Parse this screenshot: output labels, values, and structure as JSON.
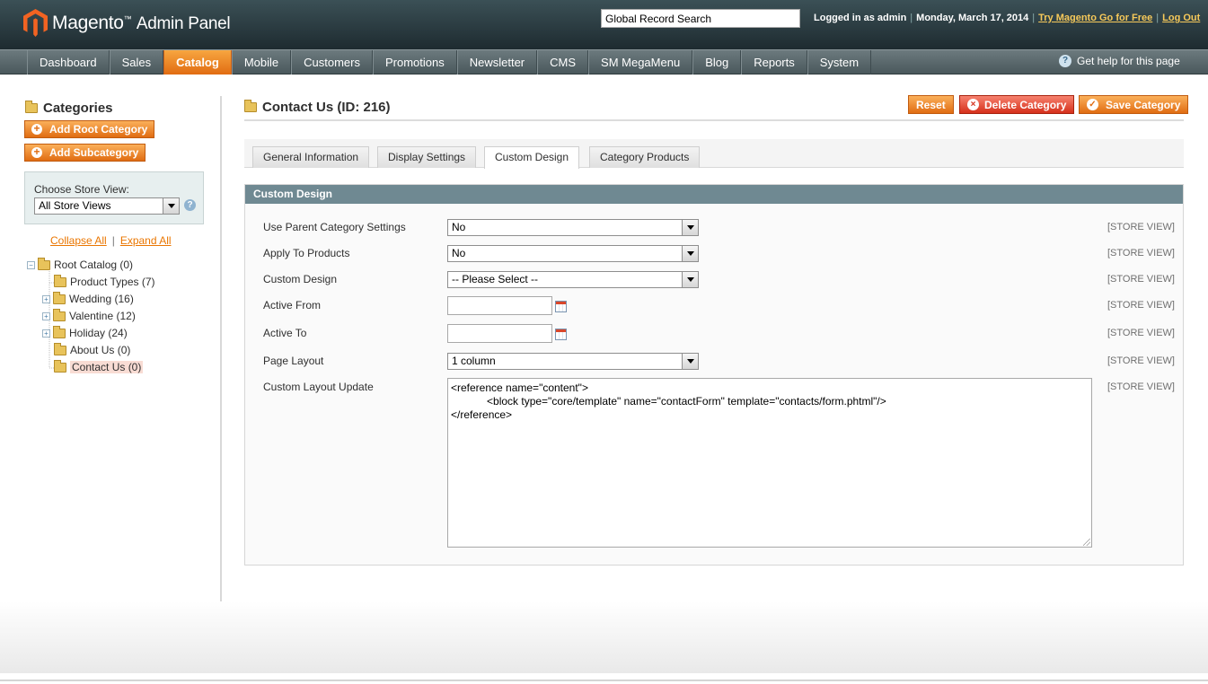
{
  "header": {
    "logo": "Magento",
    "logo_tm": "™",
    "logo_sub": "Admin Panel",
    "search_value": "Global Record Search",
    "logged_in": "Logged in as admin",
    "date": "Monday, March 17, 2014",
    "try_link": "Try Magento Go for Free",
    "logout": "Log Out",
    "sep": "|"
  },
  "nav": {
    "items": [
      "Dashboard",
      "Sales",
      "Catalog",
      "Mobile",
      "Customers",
      "Promotions",
      "Newsletter",
      "CMS",
      "SM MegaMenu",
      "Blog",
      "Reports",
      "System"
    ],
    "active": "Catalog",
    "help": "Get help for this page",
    "help_icon": "?"
  },
  "sidebar": {
    "title": "Categories",
    "add_root": "Add Root Category",
    "add_sub": "Add Subcategory",
    "plus_icon": "+",
    "store_label": "Choose Store View:",
    "store_value": "All Store Views",
    "store_help_icon": "?",
    "collapse_all": "Collapse All",
    "expand_all": "Expand All",
    "links_sep": "|",
    "tree": [
      {
        "label": "Root Catalog (0)",
        "toggle": "−"
      },
      {
        "label": "Product Types (7)",
        "toggle": ""
      },
      {
        "label": "Wedding (16)",
        "toggle": "+"
      },
      {
        "label": "Valentine (12)",
        "toggle": "+"
      },
      {
        "label": "Holiday (24)",
        "toggle": "+"
      },
      {
        "label": "About Us (0)",
        "toggle": ""
      },
      {
        "label": "Contact Us (0)",
        "toggle": ""
      }
    ],
    "selected": "Contact Us (0)"
  },
  "main": {
    "title": "Contact Us (ID: 216)",
    "reset": "Reset",
    "delete": "Delete Category",
    "delete_icon": "×",
    "save": "Save Category",
    "save_icon": "✓",
    "tabs": [
      "General Information",
      "Display Settings",
      "Custom Design",
      "Category Products"
    ],
    "active_tab": "Custom Design",
    "section_title": "Custom Design",
    "scope_label": "[STORE VIEW]",
    "fields": {
      "use_parent": {
        "label": "Use Parent Category Settings",
        "value": "No"
      },
      "apply_products": {
        "label": "Apply To Products",
        "value": "No"
      },
      "custom_design": {
        "label": "Custom Design",
        "value": "-- Please Select --"
      },
      "active_from": {
        "label": "Active From",
        "value": ""
      },
      "active_to": {
        "label": "Active To",
        "value": ""
      },
      "page_layout": {
        "label": "Page Layout",
        "value": "1 column"
      },
      "layout_update": {
        "label": "Custom Layout Update",
        "value": "<reference name=\"content\">\n            <block type=\"core/template\" name=\"contactForm\" template=\"contacts/form.phtml\"/>\n</reference>"
      }
    }
  },
  "colors": {
    "accent": "#e06c12",
    "header_bg": "#2a3a3f",
    "section_head": "#6f8992",
    "danger": "#d5301b"
  }
}
